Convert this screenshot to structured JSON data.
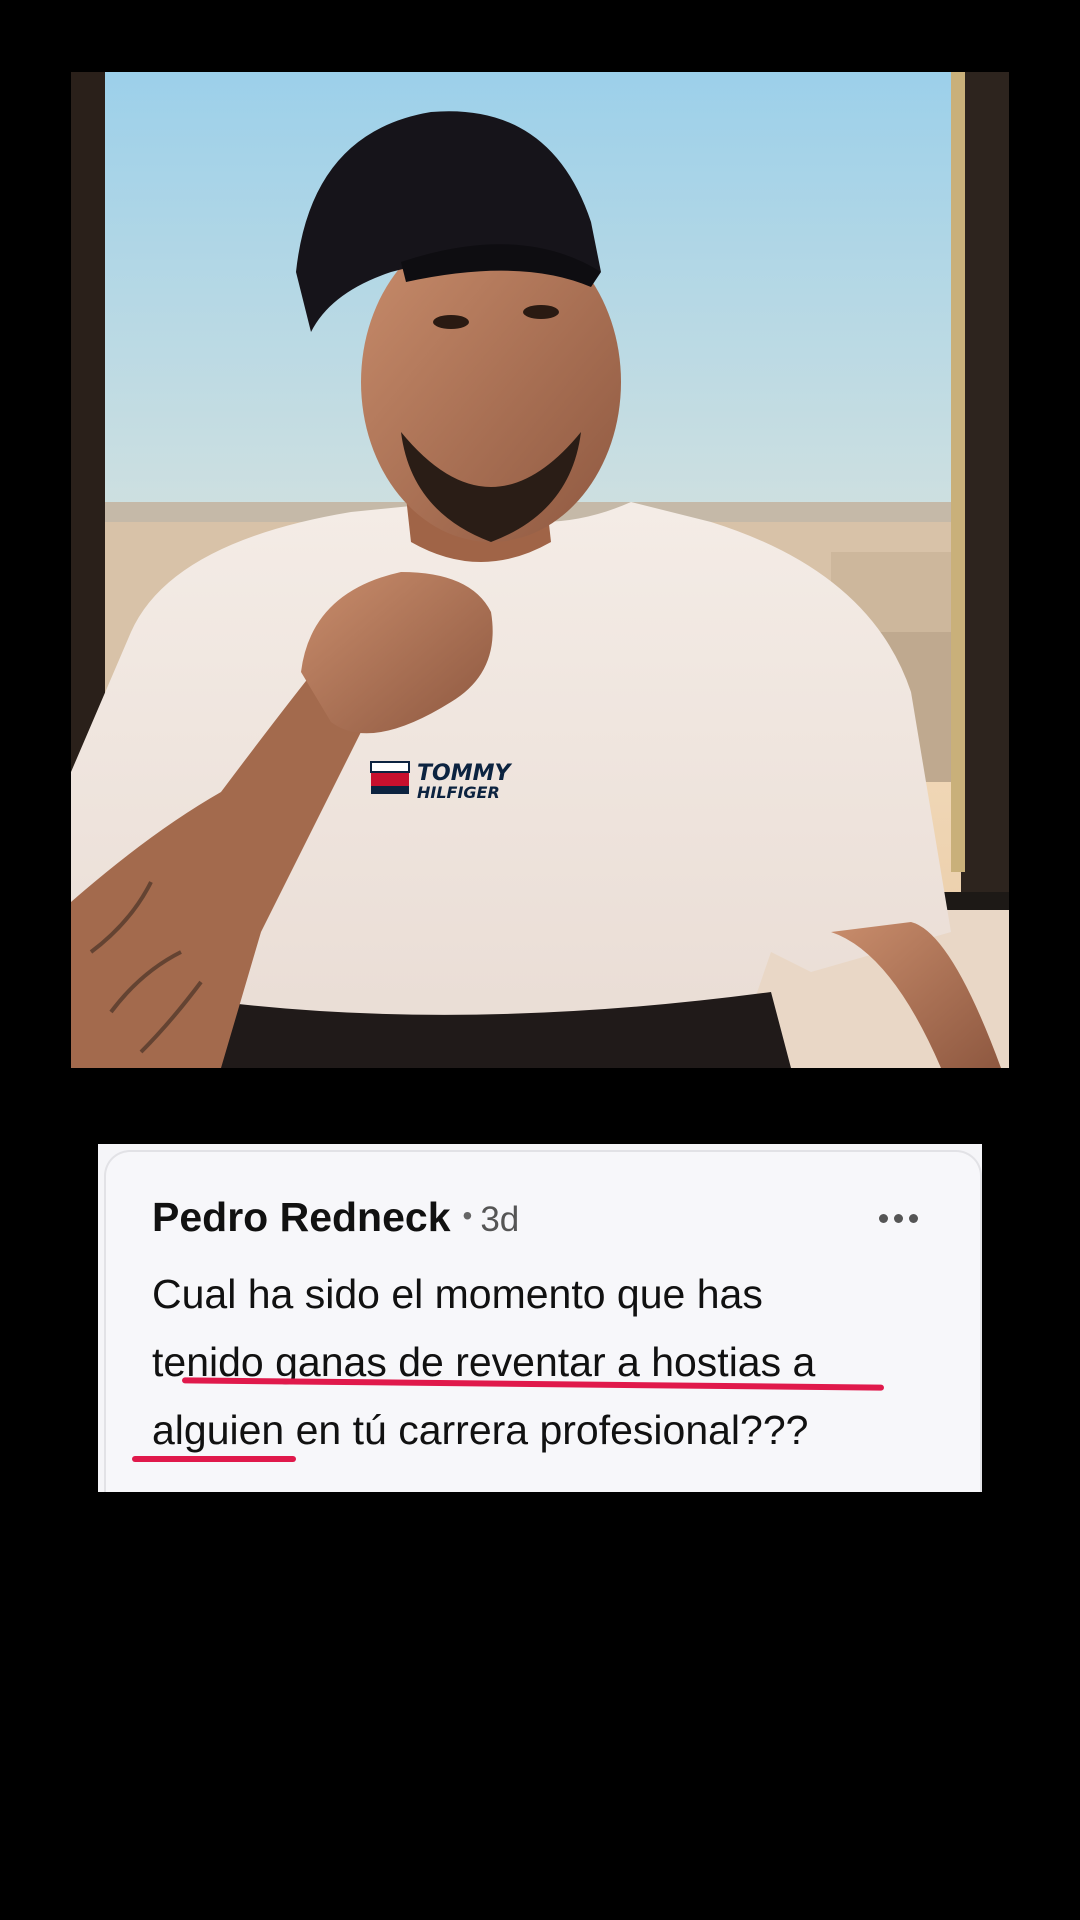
{
  "comment": {
    "author": "Pedro Redneck",
    "separator": "•",
    "age": "3d",
    "more_icon": "more-horizontal-icon",
    "text_line1": "Cual ha sido el momento que has",
    "text_line2_plain": "tenido ",
    "text_line2_highlight": "ganas de reventar a hostias a",
    "text_line3_highlight": "alguien",
    "text_line3_plain": " en tú carrera profesional???",
    "highlight_color": "#e0194b"
  },
  "video": {
    "shirt_brand_top": "TOMMY",
    "shirt_brand_bottom": "HILFIGER"
  }
}
